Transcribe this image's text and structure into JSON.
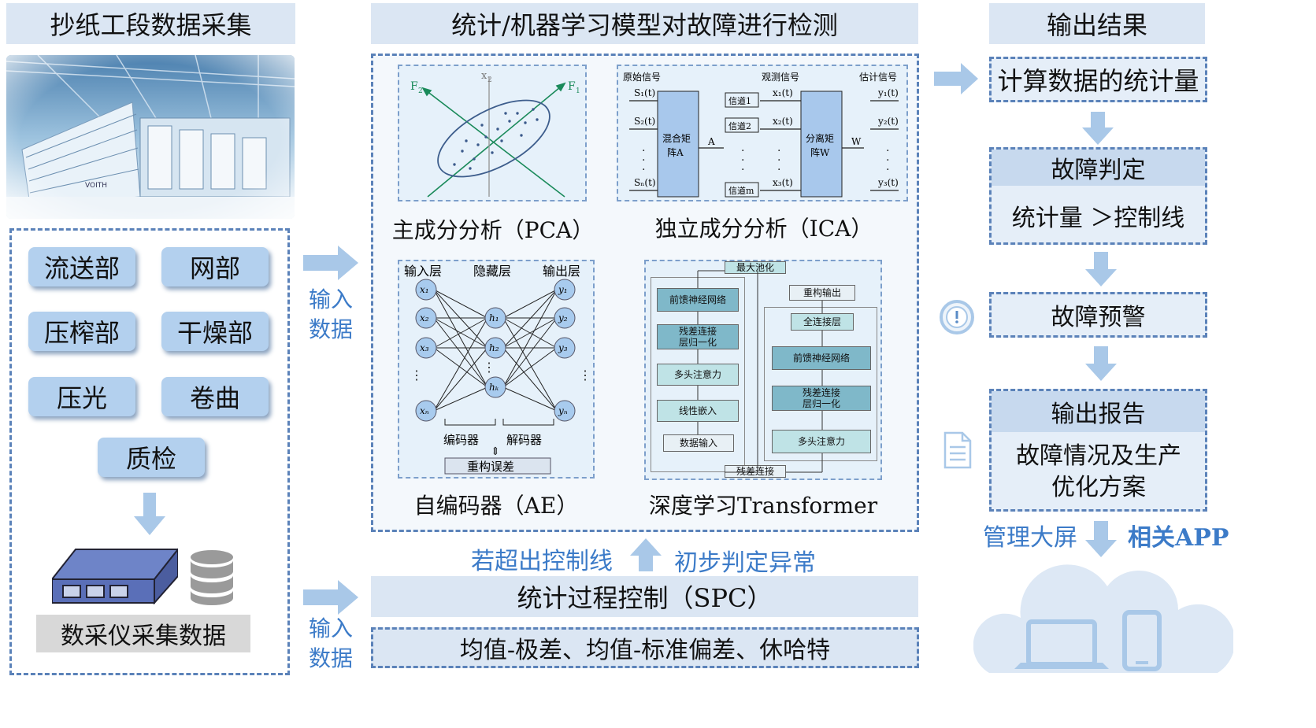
{
  "left": {
    "title": "抄纸工段数据采集",
    "sections": [
      "流送部",
      "网部",
      "压榨部",
      "干燥部",
      "压光",
      "卷曲",
      "质检"
    ],
    "device_label": "数采仪采集数据",
    "input_label_1": "输入",
    "input_label_2": "数据"
  },
  "middle": {
    "title": "统计/机器学习模型对故障进行检测",
    "pca": {
      "caption": "主成分分析（PCA）",
      "f2": "F",
      "f2sub": "2",
      "x2": "x",
      "x2sub": "2",
      "f1": "F",
      "f1sub": "1"
    },
    "ica": {
      "caption": "独立成分分析（ICA）",
      "orig": "原始信号",
      "obs": "观测信号",
      "est": "估计信号",
      "mix": "混合矩阵A",
      "sep": "分离矩阵W",
      "a": "A",
      "w": "W",
      "s1": "S₁(t)",
      "s2": "S₂(t)",
      "sn": "Sₙ(t)",
      "x1": "x₁(t)",
      "x2": "x₂(t)",
      "x3": "x₃(t)",
      "y1": "y₁(t)",
      "y2": "y₂(t)",
      "y3": "y₃(t)",
      "ch1": "信道1",
      "ch2": "信道2",
      "chm": "信道m"
    },
    "ae": {
      "caption": "自编码器（AE）",
      "input": "输入层",
      "hidden": "隐藏层",
      "output": "输出层",
      "x1": "x₁",
      "x2": "x₂",
      "x3": "x₃",
      "xn": "xₙ",
      "h1": "h₁",
      "h2": "h₂",
      "hk": "hₖ",
      "y1": "y₁",
      "y2": "y₂",
      "y3": "y₃",
      "yn": "yₙ",
      "encoder": "编码器",
      "decoder": "解码器",
      "recon_error": "重构误差"
    },
    "transformer": {
      "caption": "深度学习Transformer",
      "maxpool": "最大池化",
      "ffn": "前馈神经网络",
      "resnorm": "残差连接\n层归一化",
      "mha": "多头注意力",
      "linear": "线性嵌入",
      "datain": "数据输入",
      "recon_out": "重构输出",
      "fc": "全连接层",
      "residual": "残差连接"
    },
    "if_exceed": "若超出控制线",
    "initial_judge": "初步判定异常",
    "spc_title": "统计过程控制（SPC）",
    "spc_methods": "均值-极差、均值-标准偏差、休哈特",
    "input_label_1": "输入",
    "input_label_2": "数据"
  },
  "right": {
    "title": "输出结果",
    "calc_stats": "计算数据的统计量",
    "fault_judge": "故障判定",
    "stat_vs_ctrl": "统计量 ＞控制线",
    "fault_warning": "故障预警",
    "output_report": "输出报告",
    "report_content": "故障情况及生产优化方案",
    "screen": "管理大屏",
    "app": "相关APP"
  },
  "colors": {
    "accent": "#3c7bc8",
    "header_bg": "#dbe6f3",
    "dashed": "#5b82b9",
    "button": "#b3d0ee"
  }
}
